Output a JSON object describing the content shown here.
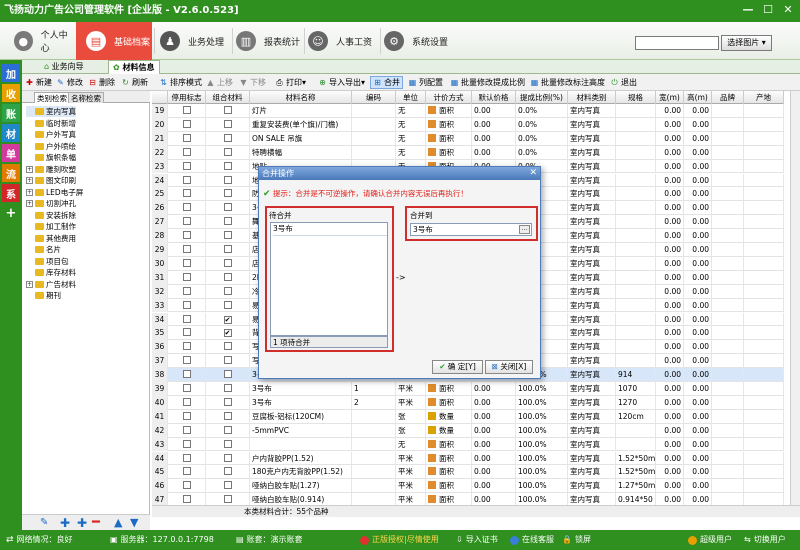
{
  "app": {
    "title": "飞扬动力广告公司管理软件 [企业版 - V2.6.0.523]",
    "win_min": "—",
    "win_max": "☐",
    "win_close": "✕"
  },
  "nav": {
    "items": [
      {
        "label": "个人中心"
      },
      {
        "label": "基础档案"
      },
      {
        "label": "业务处理"
      },
      {
        "label": "报表统计"
      },
      {
        "label": "人事工资"
      },
      {
        "label": "系统设置"
      }
    ],
    "search_value": "",
    "choose_pic": "选择图片",
    "dropdown": "▾"
  },
  "sidebar": {
    "items": [
      "加",
      "收",
      "账",
      "材",
      "单",
      "流",
      "系",
      "+"
    ]
  },
  "tabs": [
    {
      "label": "业务向导"
    },
    {
      "label": "材料信息"
    }
  ],
  "toolbar": {
    "items": [
      "新建",
      "修改",
      "删除",
      "刷新",
      "排序模式",
      "上移",
      "下移",
      "打印",
      "导入导出",
      "合并",
      "列配置",
      "批量修改提成比例",
      "批量修改标注高度",
      "退出"
    ]
  },
  "left": {
    "tabs": [
      "类别检索",
      "名称检索"
    ],
    "tree": [
      {
        "label": "室内写真",
        "exp": false
      },
      {
        "label": "临时新增",
        "exp": false
      },
      {
        "label": "户外写真",
        "exp": false
      },
      {
        "label": "户外喷绘",
        "exp": false
      },
      {
        "label": "旗帜条幅",
        "exp": false
      },
      {
        "label": "雕刻吹塑",
        "exp": true
      },
      {
        "label": "图文印刷",
        "exp": true
      },
      {
        "label": "LED电子屏",
        "exp": true
      },
      {
        "label": "切割冲孔",
        "exp": true
      },
      {
        "label": "安装拆除",
        "exp": false
      },
      {
        "label": "加工制作",
        "exp": false
      },
      {
        "label": "其他费用",
        "exp": false
      },
      {
        "label": "名片",
        "exp": false
      },
      {
        "label": "项目包",
        "exp": false
      },
      {
        "label": "库存材料",
        "exp": false
      },
      {
        "label": "广告材料",
        "exp": true
      },
      {
        "label": "期刊",
        "exp": false
      }
    ]
  },
  "grid": {
    "headers": [
      "",
      "停用标志",
      "组合材料",
      "材料名称",
      "编码",
      "单位",
      "计价方式",
      "默认价格",
      "提成比例(%)",
      "材料类别",
      "规格",
      "宽(m)",
      "高(m)",
      "品牌",
      "产地"
    ],
    "rows": [
      {
        "n": "19",
        "c1": false,
        "c2": false,
        "name": "灯片",
        "code": "",
        "unit": "无",
        "price_type": "面积",
        "price": "0.00",
        "rate": "0.0%",
        "cat": "室内写真",
        "spec": "",
        "w": "0.00",
        "h": "0.00",
        "sw": "#e08b2c"
      },
      {
        "n": "20",
        "c1": false,
        "c2": false,
        "name": "重复安装费(单个旗)/门檐)",
        "code": "",
        "unit": "无",
        "price_type": "面积",
        "price": "0.00",
        "rate": "0.0%",
        "cat": "室内写真",
        "spec": "",
        "w": "0.00",
        "h": "0.00",
        "sw": "#e08b2c"
      },
      {
        "n": "21",
        "c1": false,
        "c2": false,
        "name": "ON SALE 吊旗",
        "code": "",
        "unit": "无",
        "price_type": "面积",
        "price": "0.00",
        "rate": "0.0%",
        "cat": "室内写真",
        "spec": "",
        "w": "0.00",
        "h": "0.00",
        "sw": "#e08b2c"
      },
      {
        "n": "22",
        "c1": false,
        "c2": false,
        "name": "特聘横幅",
        "code": "",
        "unit": "无",
        "price_type": "面积",
        "price": "0.00",
        "rate": "0.0%",
        "cat": "室内写真",
        "spec": "",
        "w": "0.00",
        "h": "0.00",
        "sw": "#e08b2c"
      },
      {
        "n": "23",
        "c1": false,
        "c2": false,
        "name": "地贴",
        "code": "",
        "unit": "无",
        "price_type": "面积",
        "price": "0.00",
        "rate": "0.0%",
        "cat": "室内写真",
        "spec": "",
        "w": "0.00",
        "h": "0.00",
        "sw": "#e08b2c"
      },
      {
        "n": "24",
        "c1": false,
        "c2": false,
        "name": "地毯",
        "code": "",
        "unit": "无",
        "price_type": "面积",
        "price": "0.00",
        "rate": "0.0%",
        "cat": "室内写真",
        "spec": "",
        "w": "0.00",
        "h": "0.00",
        "sw": "#e08b2c"
      },
      {
        "n": "25",
        "c1": false,
        "c2": false,
        "name": "防撞条",
        "code": "",
        "unit": "无",
        "price_type": "面积",
        "price": "0.00",
        "rate": "0.0%",
        "cat": "室内写真",
        "spec": "",
        "w": "0.00",
        "h": "0.00",
        "sw": "#e08b2c"
      },
      {
        "n": "26",
        "c1": false,
        "c2": false,
        "name": "3号布",
        "code": "",
        "unit": "无",
        "price_type": "面积",
        "price": "0.00",
        "rate": "0.0%",
        "cat": "室内写真",
        "spec": "",
        "w": "0.00",
        "h": "0.00",
        "sw": "#e08b2c"
      },
      {
        "n": "27",
        "c1": false,
        "c2": false,
        "name": "舞台",
        "code": "",
        "unit": "无",
        "price_type": "面积",
        "price": "0.00",
        "rate": "0.0%",
        "cat": "室内写真",
        "spec": "",
        "w": "0.00",
        "h": "0.00",
        "sw": "#e08b2c"
      },
      {
        "n": "28",
        "c1": false,
        "c2": false,
        "name": "基础",
        "code": "",
        "unit": "无",
        "price_type": "面积",
        "price": "0.00",
        "rate": "0.0%",
        "cat": "室内写真",
        "spec": "",
        "w": "0.00",
        "h": "0.00",
        "sw": "#e08b2c"
      },
      {
        "n": "29",
        "c1": false,
        "c2": false,
        "name": "店外",
        "code": "",
        "unit": "无",
        "price_type": "面积",
        "price": "0.00",
        "rate": "0.0%",
        "cat": "室内写真",
        "spec": "",
        "w": "0.00",
        "h": "0.00",
        "sw": "#e08b2c"
      },
      {
        "n": "30",
        "c1": false,
        "c2": false,
        "name": "店内",
        "code": "",
        "unit": "无",
        "price_type": "面积",
        "price": "0.00",
        "rate": "0.0%",
        "cat": "室内写真",
        "spec": "",
        "w": "0.00",
        "h": "0.00",
        "sw": "#e08b2c"
      },
      {
        "n": "31",
        "c1": false,
        "c2": false,
        "name": "2F展",
        "code": "",
        "unit": "无",
        "price_type": "面积",
        "price": "0.00",
        "rate": "0.0%",
        "cat": "室内写真",
        "spec": "",
        "w": "0.00",
        "h": "0.00",
        "sw": "#e08b2c"
      },
      {
        "n": "32",
        "c1": false,
        "c2": false,
        "name": "冷压",
        "code": "",
        "unit": "无",
        "price_type": "面积",
        "price": "0.00",
        "rate": "0.0%",
        "cat": "室内写真",
        "spec": "",
        "w": "0.00",
        "h": "0.00",
        "sw": "#e08b2c"
      },
      {
        "n": "33",
        "c1": false,
        "c2": false,
        "name": "易拉",
        "code": "",
        "unit": "无",
        "price_type": "面积",
        "price": "0.00",
        "rate": "0.0%",
        "cat": "室内写真",
        "spec": "",
        "w": "0.00",
        "h": "0.00",
        "sw": "#e08b2c"
      },
      {
        "n": "34",
        "c1": false,
        "c2": true,
        "name": "易拉",
        "code": "",
        "unit": "无",
        "price_type": "面积",
        "price": "0.00",
        "rate": "0.0%",
        "cat": "室内写真",
        "spec": "",
        "w": "0.00",
        "h": "0.00",
        "sw": "#e08b2c"
      },
      {
        "n": "35",
        "c1": false,
        "c2": true,
        "name": "背胶",
        "code": "",
        "unit": "无",
        "price_type": "面积",
        "price": "0.00",
        "rate": "0.0%",
        "cat": "室内写真",
        "spec": "",
        "w": "0.00",
        "h": "0.00",
        "sw": "#e08b2c"
      },
      {
        "n": "36",
        "c1": false,
        "c2": false,
        "name": "写真",
        "code": "",
        "unit": "无",
        "price_type": "面积",
        "price": "0.00",
        "rate": "0.0%",
        "cat": "室内写真",
        "spec": "",
        "w": "0.00",
        "h": "0.00",
        "sw": "#e08b2c"
      },
      {
        "n": "37",
        "c1": false,
        "c2": false,
        "name": "写真",
        "code": "",
        "unit": "无",
        "price_type": "面积",
        "price": "0.00",
        "rate": "0.0%",
        "cat": "室内写真",
        "spec": "",
        "w": "0.00",
        "h": "0.00",
        "sw": "#e08b2c"
      },
      {
        "n": "38",
        "c1": false,
        "c2": false,
        "name": "3号布",
        "code": "",
        "unit": "平米",
        "price_type": "面积",
        "price": "0.00",
        "rate": "100.0%",
        "cat": "室内写真",
        "spec": "914",
        "w": "0.00",
        "h": "0.00",
        "sw": "#e08b2c",
        "sel": true
      },
      {
        "n": "39",
        "c1": false,
        "c2": false,
        "name": "3号布",
        "code": "1",
        "unit": "平米",
        "price_type": "面积",
        "price": "0.00",
        "rate": "100.0%",
        "cat": "室内写真",
        "spec": "1070",
        "w": "0.00",
        "h": "0.00",
        "sw": "#e08b2c"
      },
      {
        "n": "40",
        "c1": false,
        "c2": false,
        "name": "3号布",
        "code": "2",
        "unit": "平米",
        "price_type": "面积",
        "price": "0.00",
        "rate": "100.0%",
        "cat": "室内写真",
        "spec": "1270",
        "w": "0.00",
        "h": "0.00",
        "sw": "#e08b2c"
      },
      {
        "n": "41",
        "c1": false,
        "c2": false,
        "name": "豆腐板-铝标(120CM)",
        "code": "",
        "unit": "张",
        "price_type": "数量",
        "price": "0.00",
        "rate": "100.0%",
        "cat": "室内写真",
        "spec": "120cm",
        "w": "0.00",
        "h": "0.00",
        "sw": "#d9a200"
      },
      {
        "n": "42",
        "c1": false,
        "c2": false,
        "name": "-5mmPVC",
        "code": "",
        "unit": "张",
        "price_type": "数量",
        "price": "0.00",
        "rate": "100.0%",
        "cat": "室内写真",
        "spec": "",
        "w": "0.00",
        "h": "0.00",
        "sw": "#d9a200"
      },
      {
        "n": "43",
        "c1": false,
        "c2": false,
        "name": "",
        "code": "",
        "unit": "无",
        "price_type": "面积",
        "price": "0.00",
        "rate": "100.0%",
        "cat": "室内写真",
        "spec": "",
        "w": "0.00",
        "h": "0.00",
        "sw": "#e08b2c"
      },
      {
        "n": "44",
        "c1": false,
        "c2": false,
        "name": "户内背胶PP(1.52)",
        "code": "",
        "unit": "平米",
        "price_type": "面积",
        "price": "0.00",
        "rate": "100.0%",
        "cat": "室内写真",
        "spec": "1.52*50m",
        "w": "0.00",
        "h": "0.00",
        "sw": "#e08b2c"
      },
      {
        "n": "45",
        "c1": false,
        "c2": false,
        "name": "180克户内无背胶PP(1.52)",
        "code": "",
        "unit": "平米",
        "price_type": "面积",
        "price": "0.00",
        "rate": "100.0%",
        "cat": "室内写真",
        "spec": "1.52*50m",
        "w": "0.00",
        "h": "0.00",
        "sw": "#e08b2c"
      },
      {
        "n": "46",
        "c1": false,
        "c2": false,
        "name": "哑纳白胶车贴(1.27)",
        "code": "",
        "unit": "平米",
        "price_type": "面积",
        "price": "0.00",
        "rate": "100.0%",
        "cat": "室内写真",
        "spec": "1.27*50m",
        "w": "0.00",
        "h": "0.00",
        "sw": "#e08b2c"
      },
      {
        "n": "47",
        "c1": false,
        "c2": false,
        "name": "哑纳白胶车贴(0.914)",
        "code": "",
        "unit": "平米",
        "price_type": "面积",
        "price": "0.00",
        "rate": "100.0%",
        "cat": "室内写真",
        "spec": "0.914*50",
        "w": "0.00",
        "h": "0.00",
        "sw": "#e08b2c"
      }
    ],
    "footer": "本类材料合计：55个品种"
  },
  "dialog": {
    "title": "合并操作",
    "close": "✕",
    "warning": "提示：合并是不可逆操作，请确认合并内容无误后再执行！",
    "left_label": "待合并",
    "left_item": "3号布",
    "left_count": "1 项待合并",
    "arrow": "->",
    "right_label": "合并到",
    "right_value": "3号布",
    "browse": "...",
    "ok": "确 定[Y]",
    "cancel": "关闭[X]"
  },
  "status": {
    "net": "网络情况：良好",
    "server": "服务器：127.0.0.1:7798",
    "book": "账套：演示账套",
    "license": "正版授权|尽情使用",
    "import": "导入证书",
    "online": "在线客服",
    "lock": "锁屏",
    "user": "超级用户",
    "switch": "切换用户"
  },
  "colors": {
    "brand": "#2f8f1f",
    "active_nav": "#e94b3c",
    "warning": "#e0201a",
    "highlight": "#d22d2d"
  }
}
